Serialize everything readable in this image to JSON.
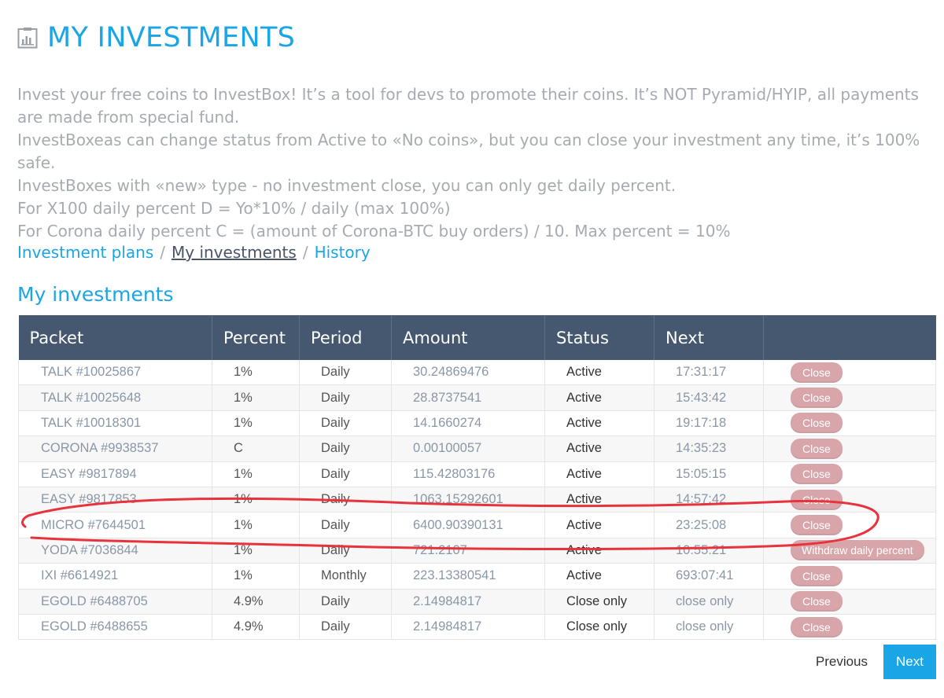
{
  "header": {
    "title": "MY INVESTMENTS",
    "icon": "chart-clipboard-icon",
    "accent": "#1aa5e6"
  },
  "intro": [
    "Invest your free coins to InvestBox! It’s a tool for devs to promote their coins. It’s NOT Pyramid/HYIP, all payments are made from special fund.",
    "InvestBoxeas can change status from Active to «No coins», but you can close your investment any time, it’s 100% safe.",
    "InvestBoxes with «new» type - no investment close, you can only get daily percent.",
    "For X100 daily percent D = Yo*10% / daily (max 100%)",
    "For Corona daily percent C = (amount of Corona-BTC buy orders) / 10. Max percent = 10%"
  ],
  "breadcrumb": {
    "plans": "Investment plans",
    "current": "My investments",
    "history": "History",
    "separator": "/"
  },
  "section_title": "My investments",
  "table": {
    "columns": [
      "Packet",
      "Percent",
      "Period",
      "Amount",
      "Status",
      "Next",
      ""
    ],
    "rows": [
      {
        "packet": "TALK #10025867",
        "percent": "1%",
        "period": "Daily",
        "amount": "30.24869476",
        "status": "Active",
        "next": "17:31:17",
        "action": "Close"
      },
      {
        "packet": "TALK #10025648",
        "percent": "1%",
        "period": "Daily",
        "amount": "28.8737541",
        "status": "Active",
        "next": "15:43:42",
        "action": "Close"
      },
      {
        "packet": "TALK #10018301",
        "percent": "1%",
        "period": "Daily",
        "amount": "14.1660274",
        "status": "Active",
        "next": "19:17:18",
        "action": "Close"
      },
      {
        "packet": "CORONA #9938537",
        "percent": "C",
        "period": "Daily",
        "amount": "0.00100057",
        "status": "Active",
        "next": "14:35:23",
        "action": "Close"
      },
      {
        "packet": "EASY #9817894",
        "percent": "1%",
        "period": "Daily",
        "amount": "115.42803176",
        "status": "Active",
        "next": "15:05:15",
        "action": "Close"
      },
      {
        "packet": "EASY #9817853",
        "percent": "1%",
        "period": "Daily",
        "amount": "1063.15292601",
        "status": "Active",
        "next": "14:57:42",
        "action": "Close"
      },
      {
        "packet": "MICRO #7644501",
        "percent": "1%",
        "period": "Daily",
        "amount": "6400.90390131",
        "status": "Active",
        "next": "23:25:08",
        "action": "Close"
      },
      {
        "packet": "YODA #7036844",
        "percent": "1%",
        "period": "Daily",
        "amount": "721.2107",
        "status": "Active",
        "next": "10:55:21",
        "action": "Withdraw daily percent"
      },
      {
        "packet": "IXI #6614921",
        "percent": "1%",
        "period": "Monthly",
        "amount": "223.13380541",
        "status": "Active",
        "next": "693:07:41",
        "action": "Close"
      },
      {
        "packet": "EGOLD #6488705",
        "percent": "4.9%",
        "period": "Daily",
        "amount": "2.14984817",
        "status": "Close only",
        "next": "close only",
        "action": "Close"
      },
      {
        "packet": "EGOLD #6488655",
        "percent": "4.9%",
        "period": "Daily",
        "amount": "2.14984817",
        "status": "Close only",
        "next": "close only",
        "action": "Close"
      }
    ]
  },
  "pagination": {
    "previous": "Previous",
    "next": "Next"
  },
  "colors": {
    "header_bg": "#465870",
    "close_button": "#d8a6aa",
    "annotation": "#e8323c"
  }
}
